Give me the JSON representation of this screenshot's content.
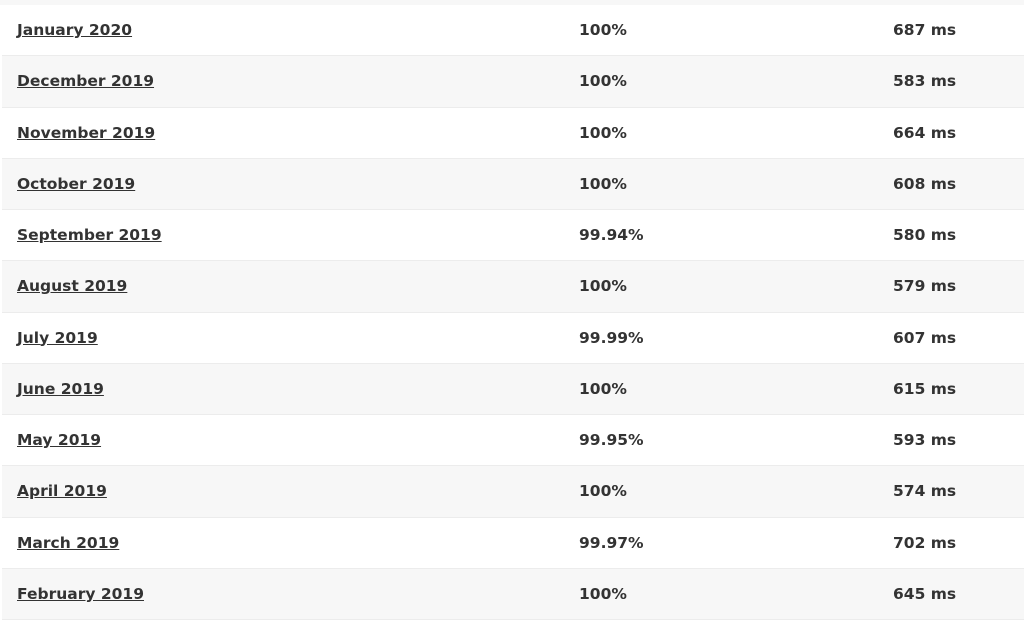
{
  "rows": [
    {
      "month": "January 2020",
      "uptime": "100%",
      "response": "687 ms"
    },
    {
      "month": "December 2019",
      "uptime": "100%",
      "response": "583 ms"
    },
    {
      "month": "November 2019",
      "uptime": "100%",
      "response": "664 ms"
    },
    {
      "month": "October 2019",
      "uptime": "100%",
      "response": "608 ms"
    },
    {
      "month": "September 2019",
      "uptime": "99.94%",
      "response": "580 ms"
    },
    {
      "month": "August 2019",
      "uptime": "100%",
      "response": "579 ms"
    },
    {
      "month": "July 2019",
      "uptime": "99.99%",
      "response": "607 ms"
    },
    {
      "month": "June 2019",
      "uptime": "100%",
      "response": "615 ms"
    },
    {
      "month": "May 2019",
      "uptime": "99.95%",
      "response": "593 ms"
    },
    {
      "month": "April 2019",
      "uptime": "100%",
      "response": "574 ms"
    },
    {
      "month": "March 2019",
      "uptime": "99.97%",
      "response": "702 ms"
    },
    {
      "month": "February 2019",
      "uptime": "100%",
      "response": "645 ms"
    }
  ],
  "colors": {
    "text": "#333333",
    "row_alt": "#f7f7f7",
    "row": "#ffffff"
  }
}
